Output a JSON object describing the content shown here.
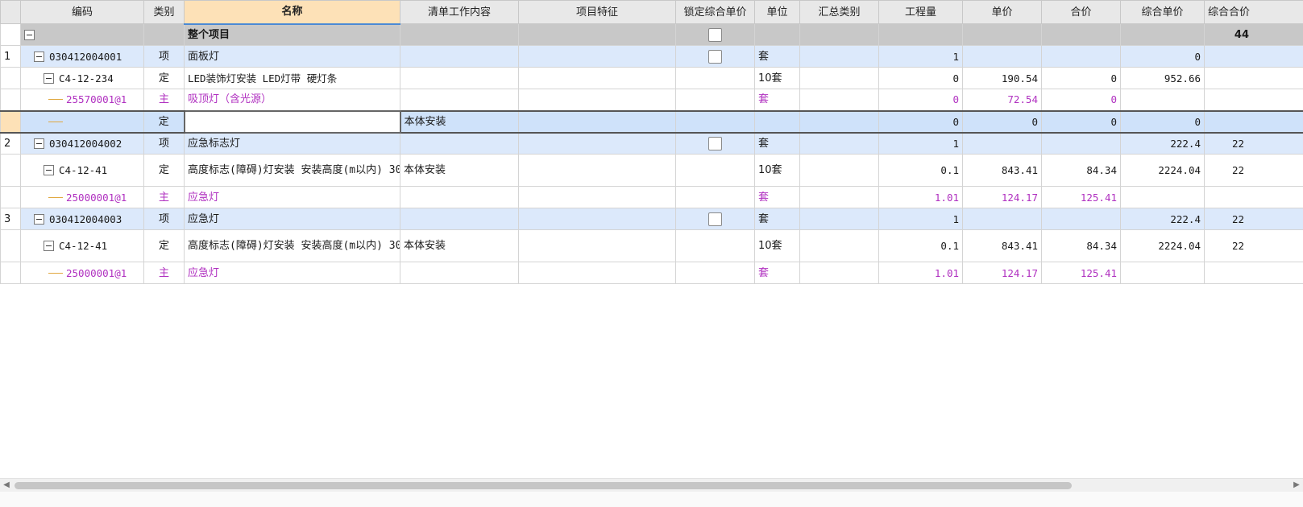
{
  "columns": {
    "code": "编码",
    "type": "类别",
    "name": "名称",
    "work": "清单工作内容",
    "feature": "项目特征",
    "lock": "锁定综合单价",
    "unit": "单位",
    "summary": "汇总类别",
    "qty": "工程量",
    "price": "单价",
    "total": "合价",
    "unit_comp": "综合单价",
    "comp_total": "综合合价"
  },
  "rows": {
    "root": {
      "name": "整个项目",
      "comp_total": "44"
    },
    "r1": {
      "num": "1",
      "code": "030412004001",
      "type": "项",
      "name": "面板灯",
      "unit": "套",
      "qty": "1",
      "unit_comp": "0"
    },
    "r1a": {
      "code": "C4-12-234",
      "type": "定",
      "name": "LED装饰灯安装 LED灯带 硬灯条",
      "unit": "10套",
      "qty": "0",
      "price": "190.54",
      "total": "0",
      "unit_comp": "952.66"
    },
    "r1b": {
      "code": "25570001@1",
      "type": "主",
      "name": "吸顶灯（含光源）",
      "unit": "套",
      "qty": "0",
      "price": "72.54",
      "total": "0"
    },
    "r1c": {
      "type": "定",
      "name": "",
      "work": "本体安装",
      "qty": "0",
      "price": "0",
      "total": "0",
      "unit_comp": "0"
    },
    "r2": {
      "num": "2",
      "code": "030412004002",
      "type": "项",
      "name": "应急标志灯",
      "unit": "套",
      "qty": "1",
      "unit_comp": "222.4",
      "comp_total": "22"
    },
    "r2a": {
      "code": "C4-12-41",
      "type": "定",
      "name": "高度标志(障碍)灯安装 安装高度(m以内) 30",
      "work": "本体安装",
      "unit": "10套",
      "qty": "0.1",
      "price": "843.41",
      "total": "84.34",
      "unit_comp": "2224.04",
      "comp_total": "22"
    },
    "r2b": {
      "code": "25000001@1",
      "type": "主",
      "name": "应急灯",
      "unit": "套",
      "qty": "1.01",
      "price": "124.17",
      "total": "125.41"
    },
    "r3": {
      "num": "3",
      "code": "030412004003",
      "type": "项",
      "name": "应急灯",
      "unit": "套",
      "qty": "1",
      "unit_comp": "222.4",
      "comp_total": "22"
    },
    "r3a": {
      "code": "C4-12-41",
      "type": "定",
      "name": "高度标志(障碍)灯安装 安装高度(m以内) 30",
      "work": "本体安装",
      "unit": "10套",
      "qty": "0.1",
      "price": "843.41",
      "total": "84.34",
      "unit_comp": "2224.04",
      "comp_total": "22"
    },
    "r3b": {
      "code": "25000001@1",
      "type": "主",
      "name": "应急灯",
      "unit": "套",
      "qty": "1.01",
      "price": "124.17",
      "total": "125.41"
    }
  },
  "colors": {
    "header_bg": "#e8e8e8",
    "sorted_header": "#fde1b7",
    "item_row": "#dce9fb",
    "root_row": "#c8c8c8",
    "material_text": "#b030c0",
    "tree_line": "#e0a840"
  },
  "icons": {
    "expand": "collapse-minus-icon",
    "tree": "tree-connector-icon",
    "scroll_left": "arrow-left-icon",
    "scroll_right": "arrow-right-icon"
  }
}
